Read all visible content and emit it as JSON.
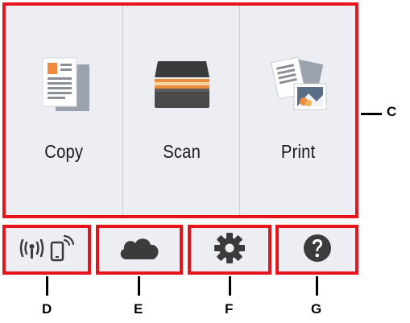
{
  "tiles": [
    {
      "label": "Copy",
      "icon": "copy-document-icon"
    },
    {
      "label": "Scan",
      "icon": "scanner-icon"
    },
    {
      "label": "Print",
      "icon": "print-photo-icon"
    }
  ],
  "bottom_buttons": [
    {
      "name": "wireless-status-button",
      "icon": "wireless-phone-icon"
    },
    {
      "name": "cloud-button",
      "icon": "cloud-icon"
    },
    {
      "name": "settings-button",
      "icon": "gear-icon"
    },
    {
      "name": "help-button",
      "icon": "question-circle-icon"
    }
  ],
  "callouts": {
    "c": "C",
    "d": "D",
    "e": "E",
    "f": "F",
    "g": "G"
  },
  "colors": {
    "highlight": "#e8141b",
    "panel_bg": "#eceef3",
    "icon_dark": "#3b3b3b"
  }
}
